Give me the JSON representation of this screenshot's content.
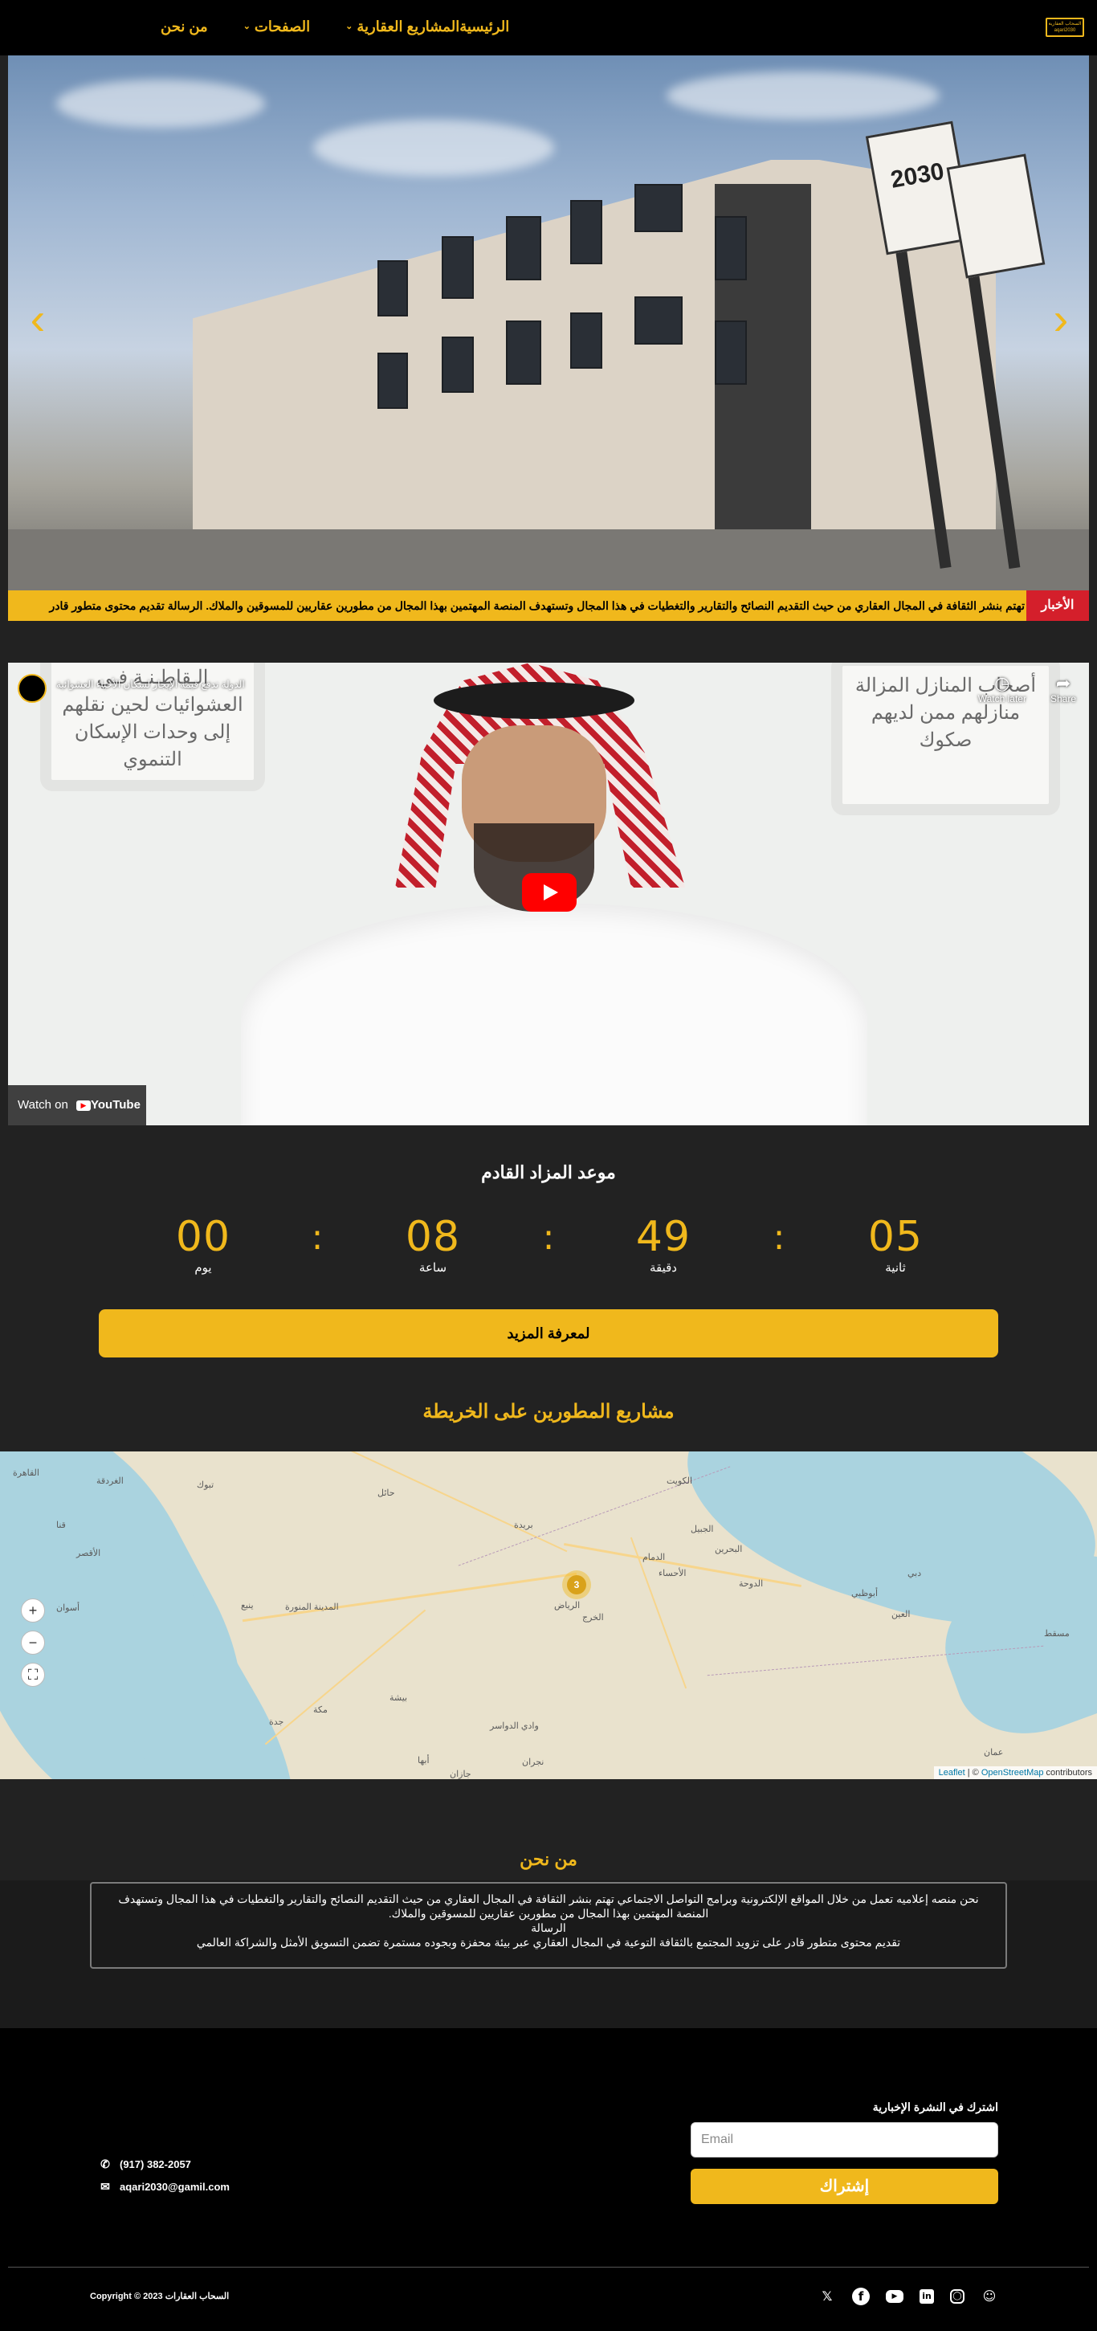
{
  "nav": {
    "logo_text": "السحاب العقارية aqari2030",
    "items": [
      {
        "label": "الرئيسية",
        "has_dropdown": false
      },
      {
        "label": "المشاريع العقارية",
        "has_dropdown": true
      },
      {
        "label": "الصفحات",
        "has_dropdown": true
      },
      {
        "label": "من نحن",
        "has_dropdown": false
      }
    ]
  },
  "hero": {
    "prev_icon": "chevron-left-icon",
    "next_icon": "chevron-right-icon",
    "sign_text": "2030"
  },
  "ticker": {
    "badge": "الأخبار",
    "text": "تهتم بنشر الثقافة في المجال العقاري من حيث التقديم النصائح والتقارير والتغطيات في هذا المجال وتستهدف المنصة المهتمين بهذا المجال من مطورين عقاريين للمسوقين والملاك. الرسالة تقديم محتوى متطور قادر"
  },
  "video": {
    "title": "الدولة تدفع قيمة الإيجار لسكان الأحياء العشوائية",
    "card_left": "الـقاطـنـة فـي العشوائيات لحين نقلهم إلى وحدات الإسكان التنموي",
    "card_right": "أصحاب المنازل المزالة منازلهم ممن لديهم صكوك",
    "watch_later": "Watch later",
    "share": "Share",
    "watch_on": "Watch on",
    "youtube": "YouTube"
  },
  "auction": {
    "title": "موعد المزاد القادم",
    "units": [
      {
        "value": "00",
        "label": "يوم"
      },
      {
        "value": "08",
        "label": "ساعة"
      },
      {
        "value": "49",
        "label": "دقيقة"
      },
      {
        "value": "05",
        "label": "ثانية"
      }
    ],
    "separator": ":",
    "button": "لمعرفة المزيد"
  },
  "map": {
    "title": "مشاريع المطورين على الخريطة",
    "cluster_count": "3",
    "zoom_in": "+",
    "zoom_out": "−",
    "fullscreen": "⛶",
    "attribution_leaflet": "Leaflet",
    "attribution_sep": " | © ",
    "attribution_osm": "OpenStreetMap",
    "attribution_contrib": " contributors",
    "labels": [
      "الرياض",
      "المدينة المنورة",
      "مكة",
      "جدة",
      "أبها",
      "جازان",
      "نجران",
      "حائل",
      "بريدة",
      "الدمام",
      "الأحساء",
      "الدوحة",
      "البحرين",
      "دبي",
      "أبوظبي",
      "مسقط",
      "العين",
      "تبوك",
      "بيشة",
      "الخرج",
      "وادي الدواسر",
      "عمان",
      "القاهرة",
      "أسوان",
      "الغردقة",
      "قنا",
      "الأقصر",
      "ينبع",
      "الكويت",
      "الجبيل"
    ]
  },
  "about": {
    "title": "من نحن",
    "line1": "نحن منصه إعلاميه تعمل من خلال المواقع الإلكترونية وبرامج التواصل الاجتماعي تهتم بنشر الثقافة في المجال العقاري من حيث التقديم النصائح والتقارير والتغطيات في هذا المجال وتستهدف المنصة المهتمين بهذا المجال من مطورين عقاريين للمسوقين والملاك.",
    "line2": "الرسالة",
    "line3": "تقديم محتوى متطور قادر على تزويد المجتمع بالثقافة التوعية في المجال العقاري عبر بيئة محفزة وبجوده مستمرة تضمن التسويق الأمثل والشراكة العالمي"
  },
  "footer": {
    "newsletter_label": "اشترك في النشرة الإخبارية",
    "email_placeholder": "Email",
    "subscribe": "إشتراك",
    "phone": "(917) 382-2057",
    "email": "aqari2030@gamil.com",
    "copyright": "Copyright © 2023 السحاب العقارات",
    "social": [
      "snapchat-icon",
      "instagram-icon",
      "linkedin-icon",
      "youtube-icon",
      "facebook-icon",
      "twitter-icon"
    ]
  }
}
